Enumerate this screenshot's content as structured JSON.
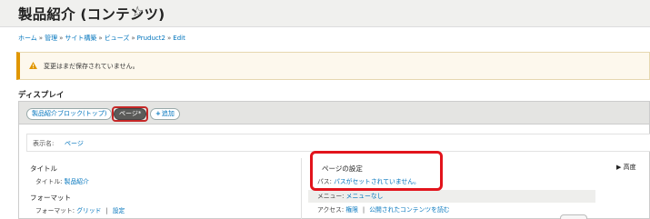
{
  "header": {
    "title": "製品紹介 (コンテンツ)",
    "star_icon": "star-outline-icon"
  },
  "breadcrumb": {
    "items": [
      "ホーム",
      "管理",
      "サイト構築",
      "ビューズ",
      "Pruduct2",
      "Edit"
    ],
    "separator": "»"
  },
  "warning": {
    "text": "変更はまだ保存されていません。",
    "icon": "warning-icon",
    "accent": "#e09600"
  },
  "section": {
    "label": "ディスプレイ"
  },
  "tabs": {
    "block": "製品紹介ブロック(トップ)",
    "page": "ページ*",
    "add": "追加"
  },
  "display_name": {
    "label": "表示名:",
    "value": "ページ"
  },
  "left": {
    "title_heading": "タイトル",
    "title_label": "タイトル:",
    "title_value": "製品紹介",
    "format_heading": "フォーマット",
    "format_label": "フォーマット:",
    "format_value": "グリッド",
    "format_settings": "設定"
  },
  "middle": {
    "heading": "ページの設定",
    "path_label": "パス:",
    "path_value": "パスがセットされていません。",
    "menu_label": "メニュー:",
    "menu_value": "メニューなし",
    "access_label": "アクセス:",
    "access_value": "権限",
    "access_value2": "公開されたコンテンツを読む"
  },
  "right": {
    "advanced": "高度"
  },
  "colors": {
    "link": "#0074bd",
    "highlight": "#e2141c"
  }
}
